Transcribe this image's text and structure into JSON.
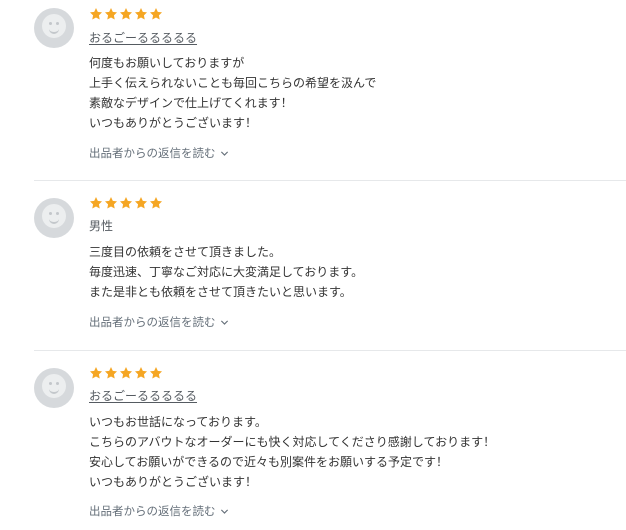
{
  "colors": {
    "star": "#f5a623",
    "text": "#333333",
    "muted": "#66707a",
    "divider": "#e6e8ea"
  },
  "reviews": [
    {
      "rating": 5,
      "reviewer": "おるごーるるるるる",
      "reviewer_is_link": true,
      "lines": [
        "何度もお願いしておりますが",
        "上手く伝えられないことも毎回こちらの希望を汲んで",
        "素敵なデザインで仕上げてくれます！",
        "いつもありがとうございます！"
      ],
      "reply_toggle": "出品者からの返信を読む"
    },
    {
      "rating": 5,
      "reviewer": "男性",
      "reviewer_is_link": false,
      "lines": [
        "三度目の依頼をさせて頂きました。",
        "毎度迅速、丁寧なご対応に大変満足しております。",
        "また是非とも依頼をさせて頂きたいと思います。"
      ],
      "reply_toggle": "出品者からの返信を読む"
    },
    {
      "rating": 5,
      "reviewer": "おるごーるるるるる",
      "reviewer_is_link": true,
      "lines": [
        "いつもお世話になっております。",
        "こちらのアバウトなオーダーにも快く対応してくださり感謝しております！",
        "安心してお願いができるので近々も別案件をお願いする予定です！",
        "いつもありがとうございます！"
      ],
      "reply_toggle": "出品者からの返信を読む"
    }
  ]
}
